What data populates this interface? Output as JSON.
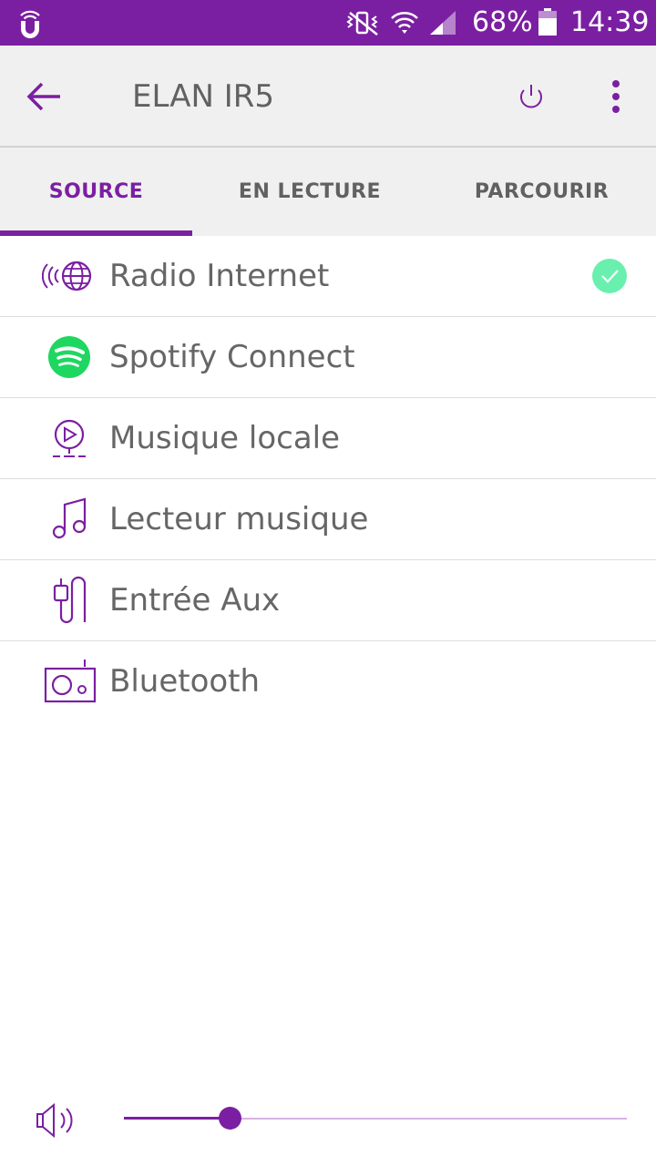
{
  "status_bar": {
    "battery_percent": "68%",
    "time": "14:39",
    "icons": [
      "app-notification-icon",
      "mute-vibrate-icon",
      "wifi-icon",
      "signal-icon",
      "battery-icon"
    ]
  },
  "app_bar": {
    "title": "ELAN IR5",
    "back_icon": "arrow-left-icon",
    "power_icon": "power-icon",
    "more_icon": "more-vert-icon"
  },
  "tabs": [
    {
      "label": "SOURCE",
      "active": true
    },
    {
      "label": "EN LECTURE",
      "active": false
    },
    {
      "label": "PARCOURIR",
      "active": false
    }
  ],
  "sources": [
    {
      "label": "Radio Internet",
      "icon": "globe-radio-icon",
      "selected": true
    },
    {
      "label": "Spotify Connect",
      "icon": "spotify-icon",
      "selected": false
    },
    {
      "label": "Musique locale",
      "icon": "local-music-icon",
      "selected": false
    },
    {
      "label": "Lecteur musique",
      "icon": "music-note-icon",
      "selected": false
    },
    {
      "label": "Entrée Aux",
      "icon": "aux-cable-icon",
      "selected": false
    },
    {
      "label": "Bluetooth",
      "icon": "radio-device-icon",
      "selected": false
    }
  ],
  "volume": {
    "level": 0.21,
    "icon": "speaker-icon"
  },
  "colors": {
    "accent": "#7b1fa2",
    "status_bar": "#7b1fa2",
    "app_bar_bg": "#f0f0f0",
    "check_green": "#69f0ae",
    "spotify_green": "#1ed760",
    "text_gray": "#666666"
  }
}
